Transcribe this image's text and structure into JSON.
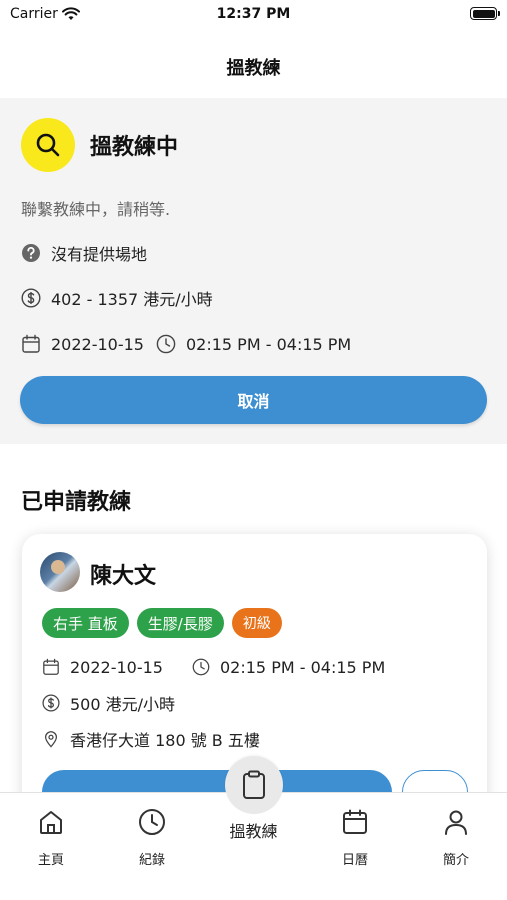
{
  "status_bar": {
    "carrier": "Carrier",
    "time": "12:37 PM"
  },
  "nav": {
    "title": "搵教練"
  },
  "search_panel": {
    "title": "搵教練中",
    "subtitle": "聯繫教練中，請稍等.",
    "venue": "沒有提供場地",
    "price": "402 - 1357 港元/小時",
    "date": "2022-10-15",
    "time": "02:15 PM - 04:15 PM",
    "cancel_label": "取消",
    "badge_color": "#f8e81c"
  },
  "applied_section": {
    "title": "已申請教練"
  },
  "coach_card": {
    "name": "陳大文",
    "tags": [
      {
        "label": "右手 直板",
        "color": "#2ea24a"
      },
      {
        "label": "生膠/長膠",
        "color": "#2ea24a"
      },
      {
        "label": "初級",
        "color": "#e8731a"
      }
    ],
    "date": "2022-10-15",
    "time": "02:15 PM - 04:15 PM",
    "price": "500 港元/小時",
    "address": "香港仔大道 180 號 B 五樓"
  },
  "tab_bar": {
    "items": [
      {
        "label": "主頁",
        "icon": "home-icon"
      },
      {
        "label": "紀錄",
        "icon": "clock-icon"
      },
      {
        "label": "搵教練",
        "icon": "clipboard-icon"
      },
      {
        "label": "日曆",
        "icon": "calendar-icon"
      },
      {
        "label": "簡介",
        "icon": "person-icon"
      }
    ]
  },
  "colors": {
    "primary": "#3d8fd1",
    "panel_bg": "#f4f4f4"
  }
}
